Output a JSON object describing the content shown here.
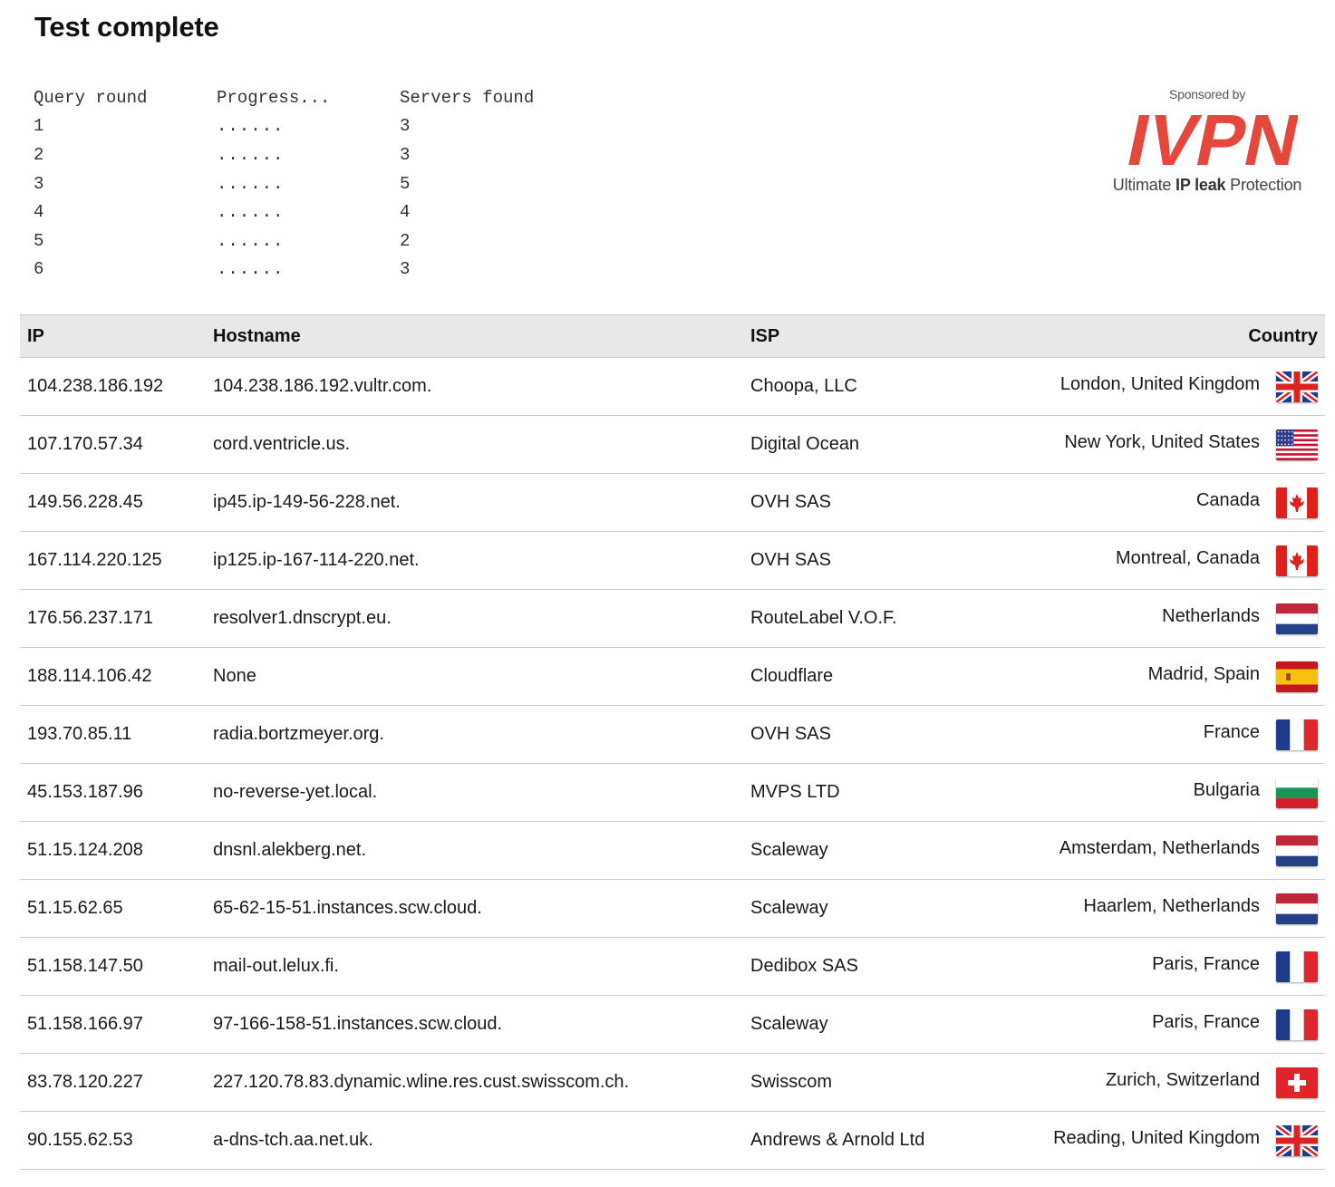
{
  "page": {
    "title": "Test complete"
  },
  "query": {
    "headers": [
      "Query round",
      "Progress...",
      "Servers found"
    ],
    "rows": [
      {
        "round": "1",
        "progress": "......",
        "found": "3"
      },
      {
        "round": "2",
        "progress": "......",
        "found": "3"
      },
      {
        "round": "3",
        "progress": "......",
        "found": "5"
      },
      {
        "round": "4",
        "progress": "......",
        "found": "4"
      },
      {
        "round": "5",
        "progress": "......",
        "found": "2"
      },
      {
        "round": "6",
        "progress": "......",
        "found": "3"
      }
    ]
  },
  "sponsor": {
    "label": "Sponsored by",
    "brand": "IVPN",
    "brand_color": "#e4473b",
    "tagline_pre": "Ultimate ",
    "tagline_bold": "IP leak",
    "tagline_post": " Protection"
  },
  "results": {
    "headers": {
      "ip": "IP",
      "hostname": "Hostname",
      "isp": "ISP",
      "country": "Country"
    },
    "rows": [
      {
        "ip": "104.238.186.192",
        "hostname": "104.238.186.192.vultr.com.",
        "isp": "Choopa, LLC",
        "country": "London, United Kingdom",
        "flag": "uk-flag-icon"
      },
      {
        "ip": "107.170.57.34",
        "hostname": "cord.ventricle.us.",
        "isp": "Digital Ocean",
        "country": "New York, United States",
        "flag": "us-flag-icon"
      },
      {
        "ip": "149.56.228.45",
        "hostname": "ip45.ip-149-56-228.net.",
        "isp": "OVH SAS",
        "country": "Canada",
        "flag": "ca-flag-icon"
      },
      {
        "ip": "167.114.220.125",
        "hostname": "ip125.ip-167-114-220.net.",
        "isp": "OVH SAS",
        "country": "Montreal, Canada",
        "flag": "ca-flag-icon"
      },
      {
        "ip": "176.56.237.171",
        "hostname": "resolver1.dnscrypt.eu.",
        "isp": "RouteLabel V.O.F.",
        "country": "Netherlands",
        "flag": "nl-flag-icon"
      },
      {
        "ip": "188.114.106.42",
        "hostname": "None",
        "isp": "Cloudflare",
        "country": "Madrid, Spain",
        "flag": "es-flag-icon"
      },
      {
        "ip": "193.70.85.11",
        "hostname": "radia.bortzmeyer.org.",
        "isp": "OVH SAS",
        "country": "France",
        "flag": "fr-flag-icon"
      },
      {
        "ip": "45.153.187.96",
        "hostname": "no-reverse-yet.local.",
        "isp": "MVPS LTD",
        "country": "Bulgaria",
        "flag": "bg-flag-icon"
      },
      {
        "ip": "51.15.124.208",
        "hostname": "dnsnl.alekberg.net.",
        "isp": "Scaleway",
        "country": "Amsterdam, Netherlands",
        "flag": "nl-flag-icon"
      },
      {
        "ip": "51.15.62.65",
        "hostname": "65-62-15-51.instances.scw.cloud.",
        "isp": "Scaleway",
        "country": "Haarlem, Netherlands",
        "flag": "nl-flag-icon"
      },
      {
        "ip": "51.158.147.50",
        "hostname": "mail-out.lelux.fi.",
        "isp": "Dedibox SAS",
        "country": "Paris, France",
        "flag": "fr-flag-icon"
      },
      {
        "ip": "51.158.166.97",
        "hostname": "97-166-158-51.instances.scw.cloud.",
        "isp": "Scaleway",
        "country": "Paris, France",
        "flag": "fr-flag-icon"
      },
      {
        "ip": "83.78.120.227",
        "hostname": "227.120.78.83.dynamic.wline.res.cust.swisscom.ch.",
        "isp": "Swisscom",
        "country": "Zurich, Switzerland",
        "flag": "ch-flag-icon"
      },
      {
        "ip": "90.155.62.53",
        "hostname": "a-dns-tch.aa.net.uk.",
        "isp": "Andrews & Arnold Ltd",
        "country": "Reading, United Kingdom",
        "flag": "uk-flag-icon"
      }
    ]
  }
}
